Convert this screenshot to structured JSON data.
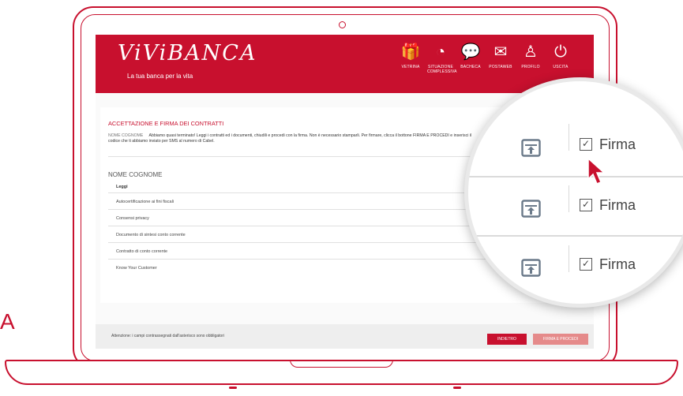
{
  "brand": {
    "logo": "ViViBANCA",
    "tagline": "La tua banca per la vita",
    "accent_color": "#c8102e"
  },
  "nav": [
    {
      "label": "VETRINA",
      "icon": "gift-icon",
      "glyph": "🎁"
    },
    {
      "label": "SITUAZIONE COMPLESSIVA",
      "icon": "pie-chart-icon",
      "glyph": "◔"
    },
    {
      "label": "BACHECA",
      "icon": "chat-icon",
      "glyph": "💬"
    },
    {
      "label": "POSTAWEB",
      "icon": "mail-icon",
      "glyph": "✉"
    },
    {
      "label": "PROFILO",
      "icon": "user-icon",
      "glyph": "♙"
    },
    {
      "label": "USCITA",
      "icon": "power-icon",
      "glyph": "⏻"
    }
  ],
  "contracts": {
    "title": "ACCETTAZIONE E FIRMA DEI CONTRATTI",
    "client_label": "NOME COGNOME",
    "intro": "Abbiamo quasi terminato! Leggi i contratti ed i documenti, chiudili e procedi con la firma. Non è necessario stamparli. Per firmare, clicca il bottone FIRMA E PROCEDI e inserisci il codice che ti abbiamo inviato per SMS al numero di Cabel.",
    "client_name": "NOME COGNOME",
    "column_read": "Leggi",
    "documents": [
      "Autocertificazione ai fini fiscali",
      "Consensi privacy",
      "Documento di sintesi conto corrente",
      "Contratto di conto corrente",
      "Know Your Customer"
    ]
  },
  "footer": {
    "note": "Attenzione: i campi contrassegnati dall'asterisco sono obbligatori",
    "back_label": "INDIETRO",
    "sign_label": "FIRMA E PROCEDI"
  },
  "magnifier": {
    "rows": [
      {
        "sign_label": "Firma",
        "checked": true
      },
      {
        "sign_label": "Firma",
        "checked": true
      },
      {
        "sign_label": "Firma",
        "checked": true
      }
    ]
  },
  "decor": {
    "side_letter": "A"
  }
}
